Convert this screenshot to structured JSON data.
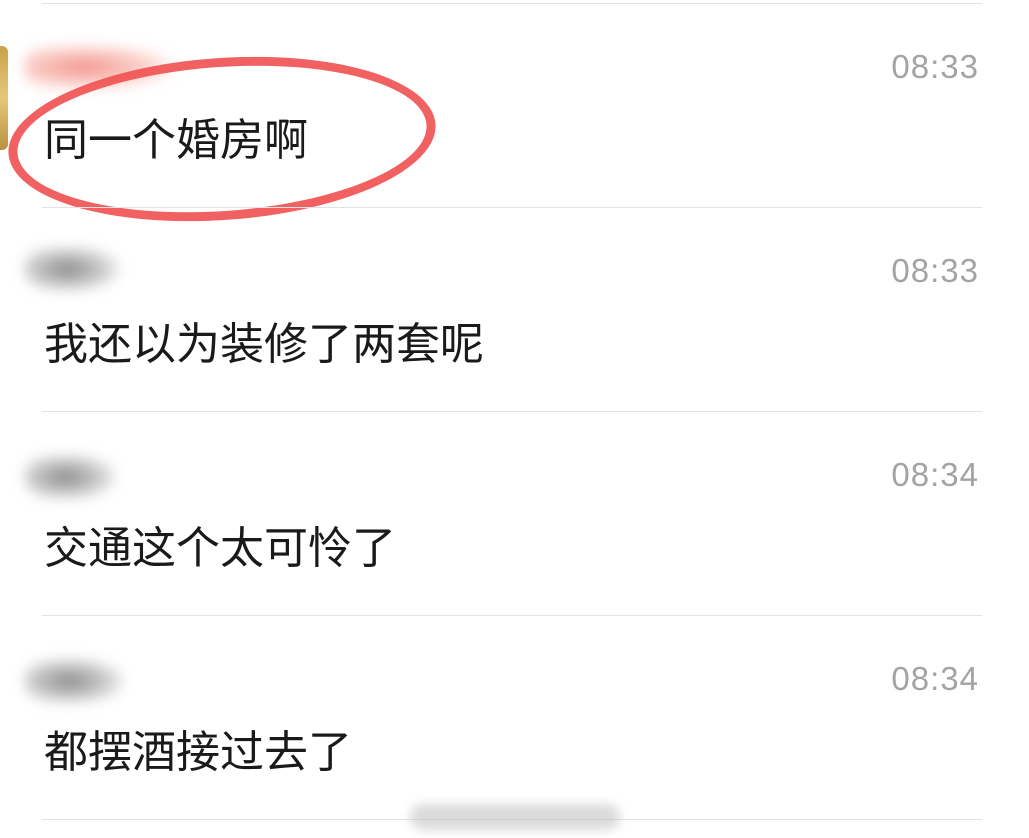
{
  "messages": [
    {
      "time": "08:33",
      "text": "同一个婚房啊",
      "sender_style": "pink",
      "highlighted": true
    },
    {
      "time": "08:33",
      "text": "我还以为装修了两套呢",
      "sender_style": "grey",
      "highlighted": false
    },
    {
      "time": "08:34",
      "text": "交通这个太可怜了",
      "sender_style": "grey",
      "highlighted": false
    },
    {
      "time": "08:34",
      "text": "都摆酒接过去了",
      "sender_style": "grey",
      "highlighted": false
    }
  ],
  "colors": {
    "highlight_ring": "#f05050",
    "time_text": "#a3a3a3",
    "message_text": "#1a1a1a",
    "divider": "#e2e2e2"
  }
}
